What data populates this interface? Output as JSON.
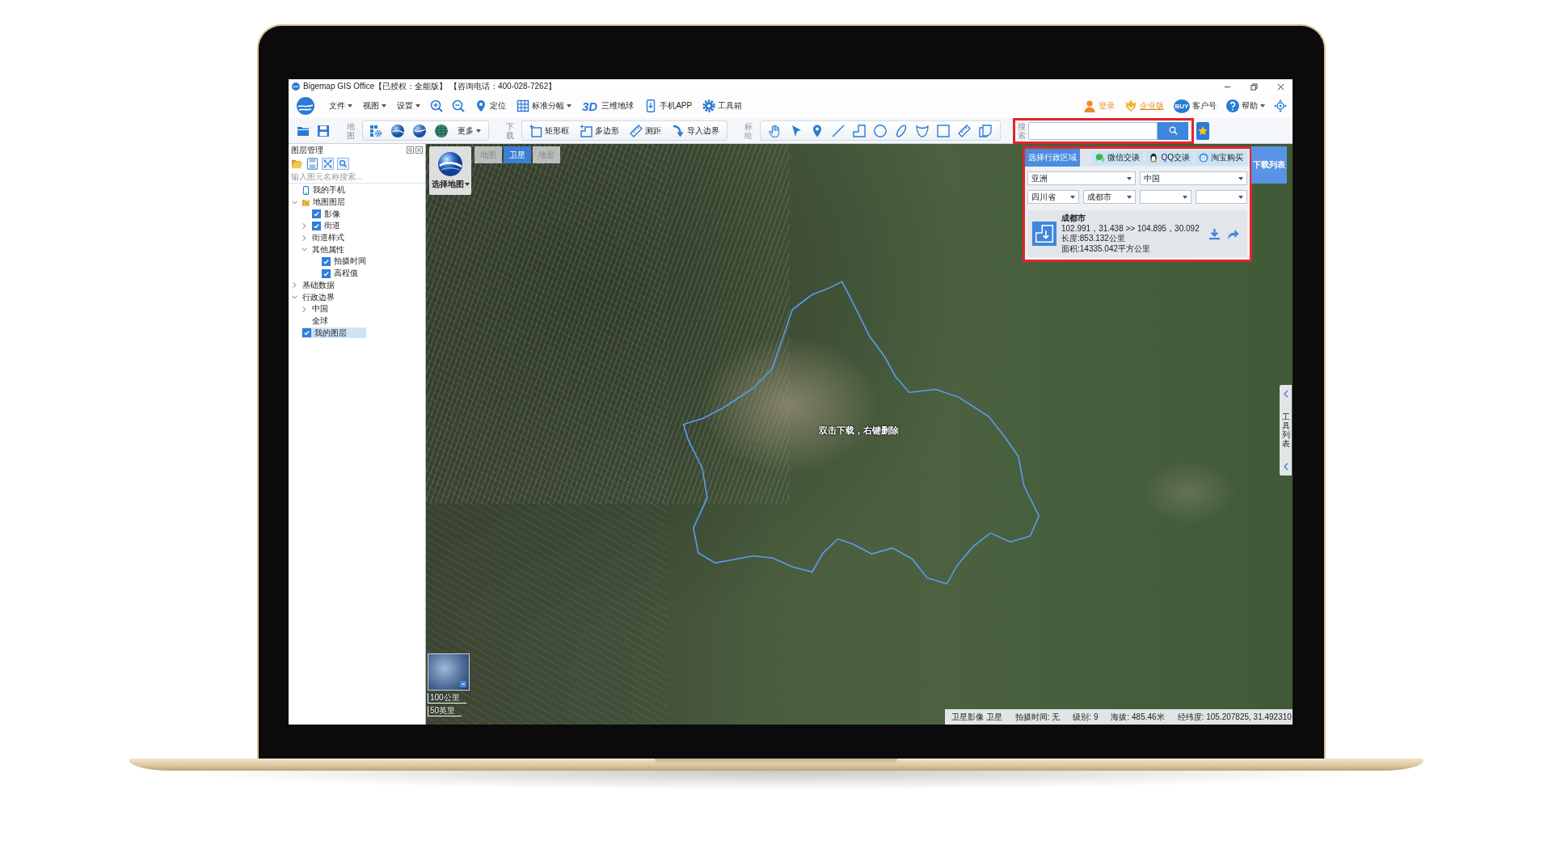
{
  "window": {
    "title": "Bigemap GIS Office【已授权：全能版】 【咨询电话：400-028-7262】"
  },
  "main_toolbar": {
    "menus": [
      "文件",
      "视图",
      "设置"
    ],
    "locate": "定位",
    "sheets": "标准分幅",
    "globe_3d": {
      "badge": "3D",
      "label": "三维地球"
    },
    "mobile_app": "手机APP",
    "toolbox": "工具箱"
  },
  "account": {
    "login": "登录",
    "enterprise": "企业版",
    "customer": {
      "badge": "BUY",
      "label": "客户号"
    },
    "help": "帮助"
  },
  "tool_toolbar": {
    "map_caption": "地图",
    "more": "更多",
    "download_caption": "下载",
    "download_tools": [
      "矩形框",
      "多边形",
      "测距",
      "导入边界"
    ],
    "plot_caption": "标绘",
    "search_caption": "搜索"
  },
  "layer_panel": {
    "title": "图层管理",
    "search": {
      "placeholder": "输入图元名称搜索..."
    },
    "tree": [
      {
        "label": "我的手机",
        "kind": "phone",
        "selected": false
      },
      {
        "label": "地图图层",
        "kind": "folder",
        "expanded": true,
        "selected": false,
        "children": [
          {
            "label": "影像",
            "kind": "check",
            "checked": true,
            "selected": false
          },
          {
            "label": "街道",
            "kind": "check",
            "checked": true,
            "expanded": false,
            "selected": false
          },
          {
            "label": "街道样式",
            "kind": "plain",
            "expanded": false,
            "selected": false
          },
          {
            "label": "其他属性",
            "kind": "plain",
            "expanded": true,
            "selected": false,
            "children": [
              {
                "label": "拍摄时间",
                "kind": "check",
                "checked": true,
                "selected": false
              },
              {
                "label": "高程值",
                "kind": "check",
                "checked": true,
                "selected": false
              }
            ]
          }
        ]
      },
      {
        "label": "基础数据",
        "kind": "plain",
        "expanded": false,
        "selected": false
      },
      {
        "label": "行政边界",
        "kind": "plain",
        "expanded": true,
        "selected": false,
        "children": [
          {
            "label": "中国",
            "kind": "plain",
            "expanded": false,
            "selected": false
          },
          {
            "label": "全球",
            "kind": "plain",
            "selected": false
          }
        ]
      },
      {
        "label": "我的图层",
        "kind": "check",
        "checked": true,
        "selected": true
      }
    ]
  },
  "map": {
    "selector": "选择地图",
    "tabs": [
      {
        "label": "地图",
        "selected": false
      },
      {
        "label": "卫星",
        "selected": true
      },
      {
        "label": "地形",
        "selected": false
      }
    ],
    "hint": "双击下载，右键删除",
    "scale": [
      "100公里",
      "50英里"
    ],
    "tool_list": "工具列表"
  },
  "region_panel": {
    "title": "选择行政区域",
    "contacts": [
      "微信交谈",
      "QQ交谈",
      "淘宝购买"
    ],
    "selects": [
      [
        "亚洲",
        "中国"
      ],
      [
        "四川省",
        "成都市"
      ]
    ],
    "result": {
      "name": "成都市",
      "extent": "102.991，31.438 >> 104.895，30.092",
      "length": "长度:853.132公里",
      "area": "面积:14335.042平方公里"
    }
  },
  "download_list": "下载列表",
  "status_bar": [
    "卫星影像 卫星",
    "拍摄时间: 无",
    "级别: 9",
    "海拔: 485.46米",
    "经纬度: 105.207825, 31.492310"
  ]
}
